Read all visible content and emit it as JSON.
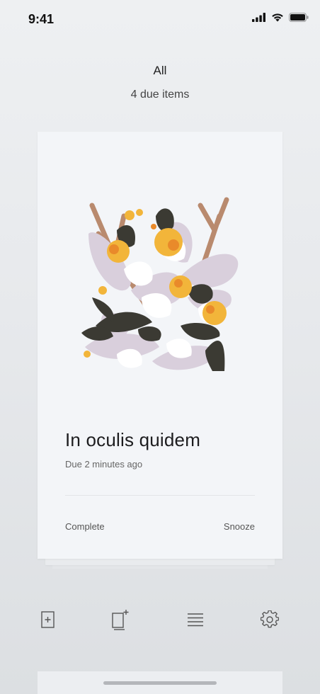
{
  "status_bar": {
    "time": "9:41"
  },
  "header": {
    "title": "All",
    "subtitle": "4 due items"
  },
  "card": {
    "title": "In oculis quidem",
    "due": "Due 2 minutes ago",
    "complete_label": "Complete",
    "snooze_label": "Snooze"
  },
  "toolbar": {
    "icons": [
      "add-card-icon",
      "new-deck-icon",
      "list-icon",
      "gear-icon"
    ]
  },
  "colors": {
    "background": "#e7e9ec",
    "card": "#f3f5f8",
    "text_primary": "#1d1d1f",
    "text_secondary": "#666666",
    "flower_yellow": "#f2b53a",
    "leaf_dark": "#3b3a33",
    "petal_lilac": "#d9cfdc",
    "branch_brown": "#b98a6e"
  }
}
